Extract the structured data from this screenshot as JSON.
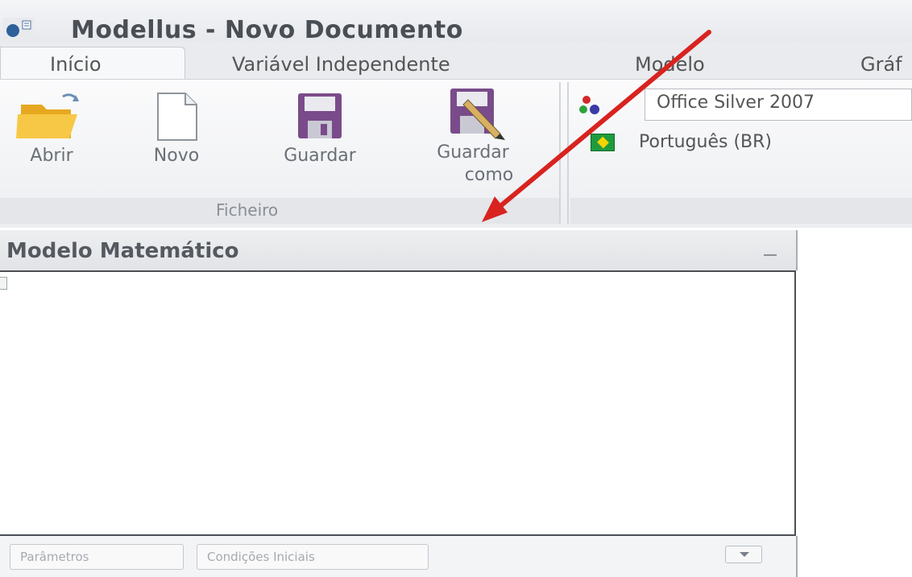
{
  "window": {
    "title": "Modellus - Novo Documento",
    "app_icon": "modellus-app-icon"
  },
  "tabs": [
    {
      "label": "Início",
      "active": true
    },
    {
      "label": "Variável Independente",
      "active": false
    },
    {
      "label": "Modelo",
      "active": false
    },
    {
      "label": "Gráf",
      "active": false
    }
  ],
  "ribbon": {
    "file_group": {
      "label": "Ficheiro",
      "buttons": [
        {
          "label": "Abrir",
          "icon": "folder-open-icon"
        },
        {
          "label": "Novo",
          "icon": "new-document-icon"
        },
        {
          "label": "Guardar",
          "icon": "save-disk-icon"
        },
        {
          "label_line1": "Guardar",
          "label_line2": "como",
          "icon": "save-as-icon"
        }
      ]
    },
    "appearance": {
      "theme_value": "Office Silver 2007",
      "language_value": "Português (BR)"
    }
  },
  "panel": {
    "title": "Modelo Matemático",
    "footer_buttons": [
      "Parâmetros",
      "Condições Iniciais"
    ]
  },
  "colors": {
    "annotation_arrow": "#d8231f",
    "title_text": "#4a4f55"
  }
}
